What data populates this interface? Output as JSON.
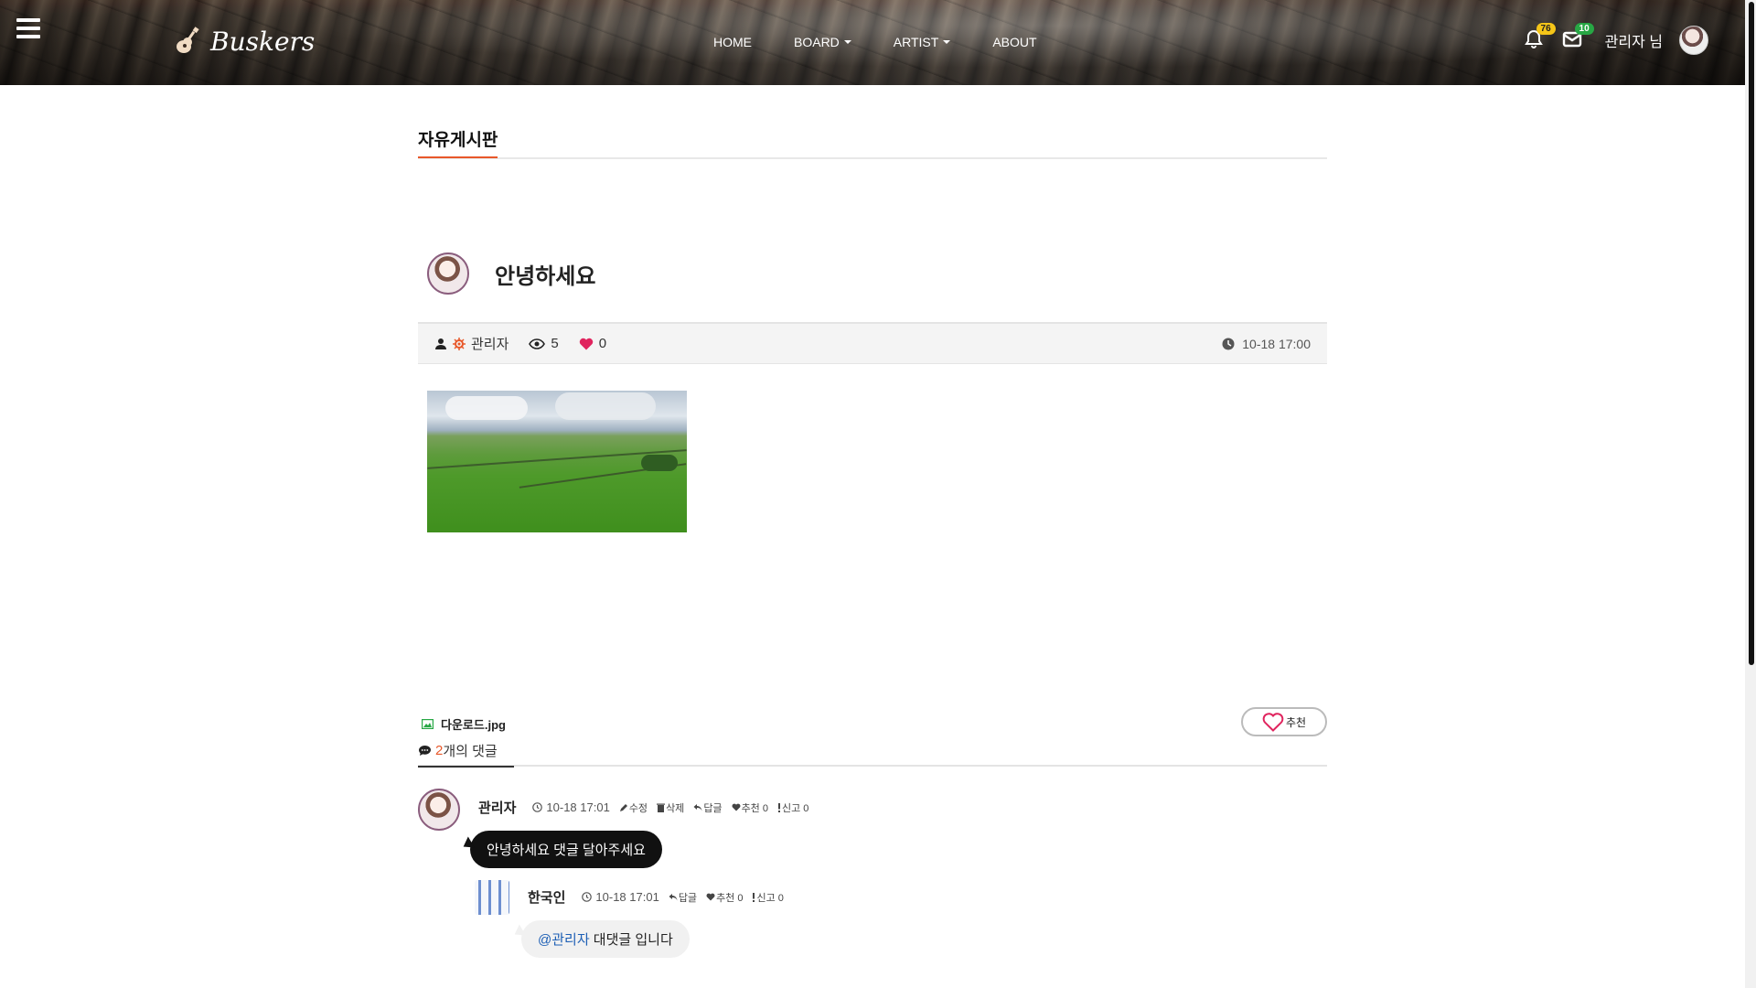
{
  "header": {
    "logo_text": "Buskers",
    "nav": [
      {
        "label": "HOME",
        "dropdown": false
      },
      {
        "label": "BOARD",
        "dropdown": true
      },
      {
        "label": "ARTIST",
        "dropdown": true
      },
      {
        "label": "ABOUT",
        "dropdown": false
      }
    ],
    "notification_count": "76",
    "message_count": "10",
    "user_greeting": "관리자 님"
  },
  "board": {
    "title": "자유게시판"
  },
  "post": {
    "title": "안녕하세요",
    "author": "관리자",
    "views": "5",
    "likes": "0",
    "datetime": "10-18 17:00",
    "attachment_name": "다운로드.jpg",
    "recommend_label": "추천"
  },
  "comments_section": {
    "count": "2",
    "count_suffix": "개의 댓글"
  },
  "comments": [
    {
      "author": "관리자",
      "time": "10-18 17:01",
      "actions": {
        "edit": "수정",
        "delete": "삭제",
        "reply": "답글",
        "recommend": "추천 0",
        "report": "신고 0"
      },
      "text": "안녕하세요 댓글 달아주세요"
    },
    {
      "author": "한국인",
      "time": "10-18 17:01",
      "actions": {
        "reply": "답글",
        "recommend": "추천 0",
        "report": "신고 0"
      },
      "mention": "@관리자",
      "text": " 대댓글 입니다"
    }
  ],
  "colors": {
    "accent": "#e8582a",
    "notification_badge": "#f5c518",
    "message_badge": "#27a744",
    "heart": "#e0245e",
    "mention": "#1d5fb5"
  }
}
